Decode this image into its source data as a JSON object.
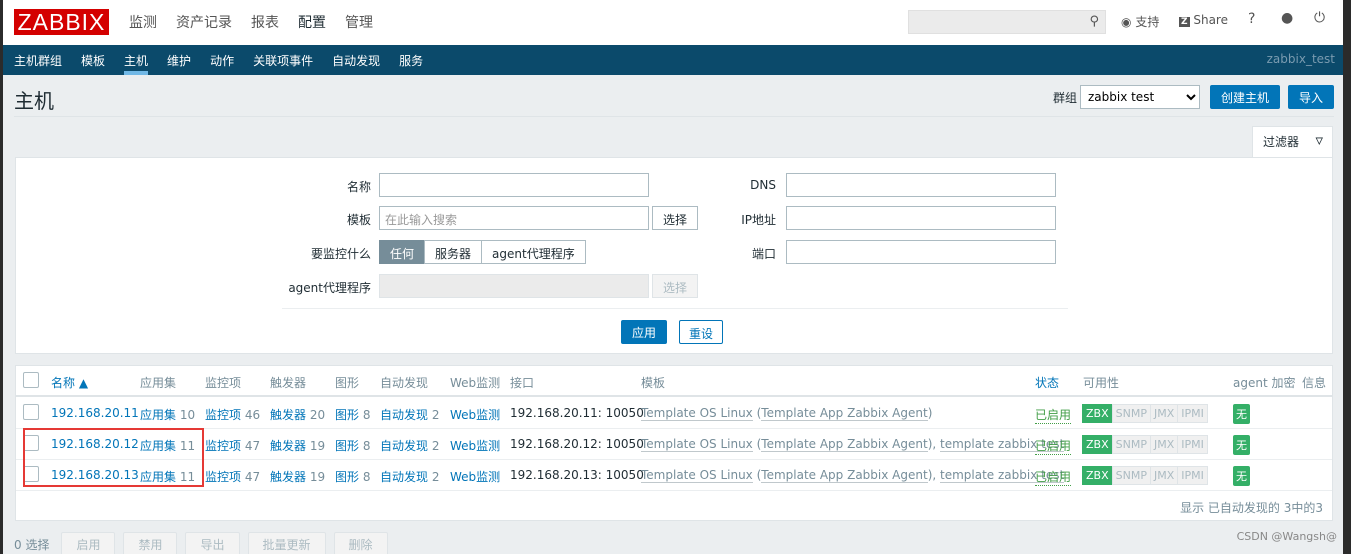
{
  "logo": "ZABBIX",
  "top_menu": [
    "监测",
    "资产记录",
    "报表",
    "配置",
    "管理"
  ],
  "top_right": {
    "support": "支持",
    "share": "Share",
    "help": "?"
  },
  "nav": {
    "items": [
      "主机群组",
      "模板",
      "主机",
      "维护",
      "动作",
      "关联项事件",
      "自动发现",
      "服务"
    ],
    "user": "zabbix_test"
  },
  "page_title": "主机",
  "header": {
    "group_label": "群组",
    "group_value": "zabbix test",
    "create_label": "创建主机",
    "import_label": "导入"
  },
  "filter": {
    "tab_label": "过滤器",
    "name_label": "名称",
    "template_label": "模板",
    "template_placeholder": "在此输入搜索",
    "select_label": "选择",
    "monitored_by_label": "要监控什么",
    "monitored_by": [
      "任何",
      "服务器",
      "agent代理程序"
    ],
    "proxy_label": "agent代理程序",
    "proxy_select": "选择",
    "dns_label": "DNS",
    "ip_label": "IP地址",
    "port_label": "端口",
    "apply": "应用",
    "reset": "重设"
  },
  "table": {
    "headers": {
      "name": "名称 ▲",
      "apps": "应用集",
      "items": "监控项",
      "triggers": "触发器",
      "graphs": "图形",
      "discovery": "自动发现",
      "web": "Web监测",
      "interface": "接口",
      "templates": "模板",
      "status": "状态",
      "availability": "可用性",
      "encryption": "agent 加密",
      "info": "信息"
    },
    "rows": [
      {
        "name": "192.168.20.11",
        "apps": "应用集",
        "apps_n": "10",
        "items": "监控项",
        "items_n": "46",
        "triggers": "触发器",
        "triggers_n": "20",
        "graphs": "图形",
        "graphs_n": "8",
        "discovery": "自动发现",
        "discovery_n": "2",
        "web": "Web监测",
        "interface": "192.168.20.11: 10050",
        "t1": "Template OS Linux",
        "t2": "Template App Zabbix Agent",
        "t3": "",
        "status": "已启用",
        "enc": "无"
      },
      {
        "name": "192.168.20.12",
        "apps": "应用集",
        "apps_n": "11",
        "items": "监控项",
        "items_n": "47",
        "triggers": "触发器",
        "triggers_n": "19",
        "graphs": "图形",
        "graphs_n": "8",
        "discovery": "自动发现",
        "discovery_n": "2",
        "web": "Web监测",
        "interface": "192.168.20.12: 10050",
        "t1": "Template OS Linux",
        "t2": "Template App Zabbix Agent",
        "t3": "template zabbix test",
        "status": "已启用",
        "enc": "无"
      },
      {
        "name": "192.168.20.13",
        "apps": "应用集",
        "apps_n": "11",
        "items": "监控项",
        "items_n": "47",
        "triggers": "触发器",
        "triggers_n": "19",
        "graphs": "图形",
        "graphs_n": "8",
        "discovery": "自动发现",
        "discovery_n": "2",
        "web": "Web监测",
        "interface": "192.168.20.13: 10050",
        "t1": "Template OS Linux",
        "t2": "Template App Zabbix Agent",
        "t3": "template zabbix test",
        "status": "已启用",
        "enc": "无"
      }
    ],
    "availability": [
      "ZBX",
      "SNMP",
      "JMX",
      "IPMI"
    ],
    "footer": "显示 已自动发现的 3中的3"
  },
  "actions": {
    "selected": "0 选择",
    "buttons": [
      "启用",
      "禁用",
      "导出",
      "批量更新",
      "删除"
    ]
  },
  "watermark": "CSDN @Wangsh@"
}
